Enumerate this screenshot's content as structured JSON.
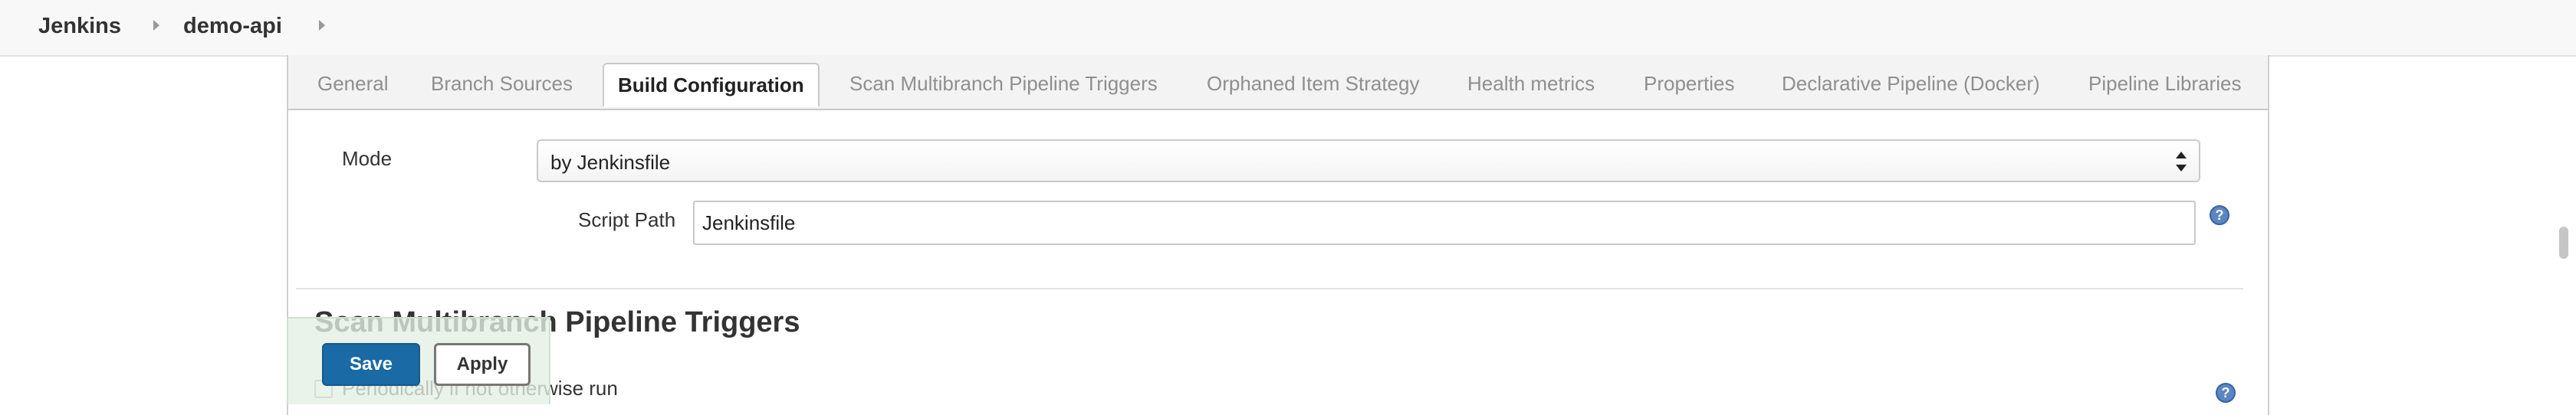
{
  "breadcrumb": {
    "items": [
      "Jenkins",
      "demo-api"
    ]
  },
  "tabs": [
    "General",
    "Branch Sources",
    "Build Configuration",
    "Scan Multibranch Pipeline Triggers",
    "Orphaned Item Strategy",
    "Health metrics",
    "Properties",
    "Declarative Pipeline (Docker)",
    "Pipeline Libraries"
  ],
  "active_tab": "Build Configuration",
  "build_config": {
    "mode_label": "Mode",
    "mode_value": "by Jenkinsfile",
    "script_path_label": "Script Path",
    "script_path_value": "Jenkinsfile"
  },
  "scan_triggers": {
    "title": "Scan Multibranch Pipeline Triggers",
    "periodic_label": "Periodically if not otherwise run"
  },
  "actions": {
    "save_label": "Save",
    "apply_label": "Apply"
  },
  "help_glyph": "?",
  "colors": {
    "save_button": "#1a6aa5",
    "help_icon": "#5c86c3",
    "save_bar": "#e4f0e4"
  }
}
